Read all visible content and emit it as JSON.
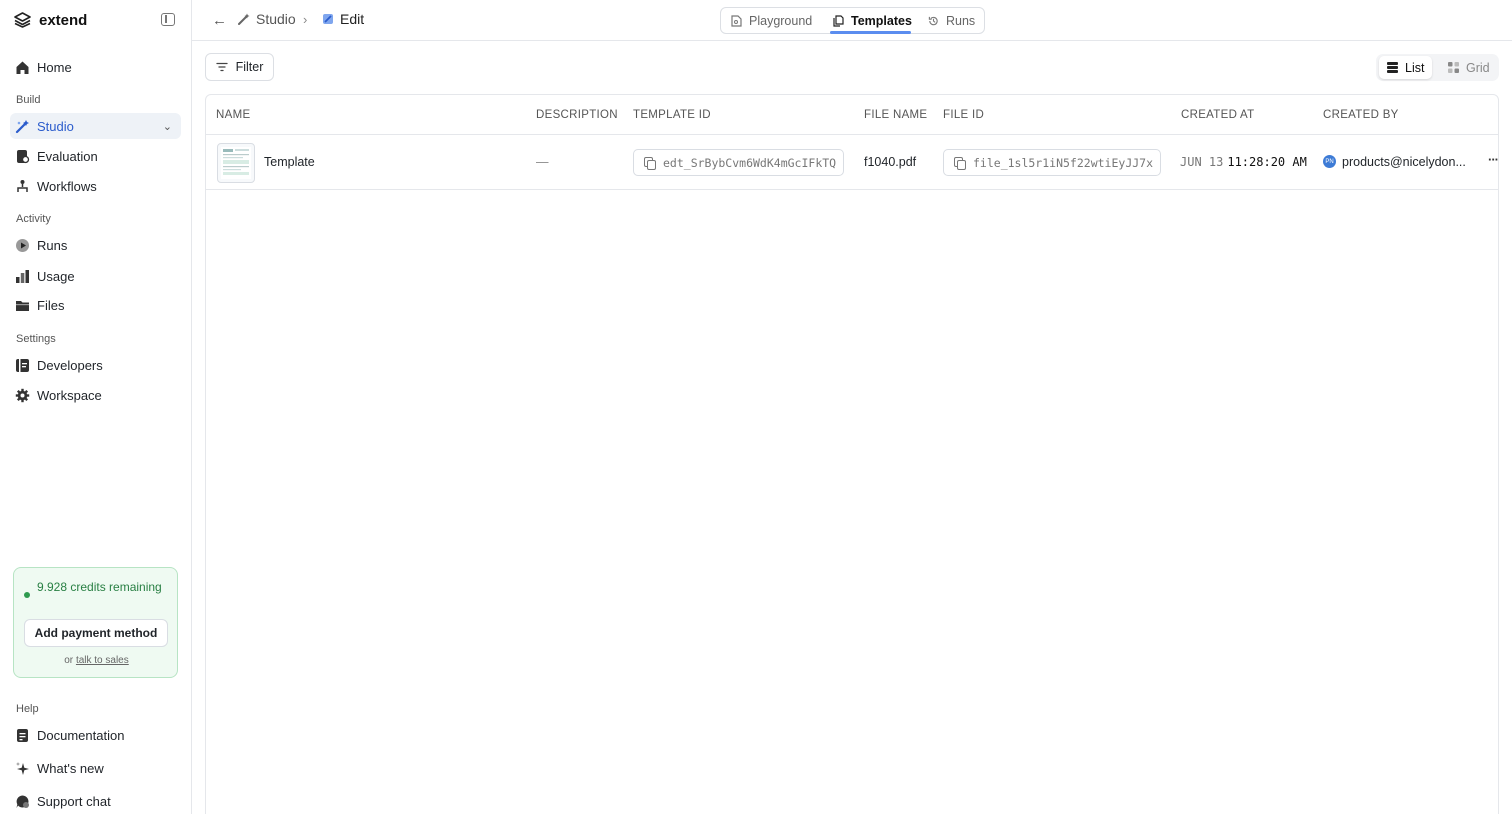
{
  "sidebar": {
    "brand": "extend",
    "items": {
      "home": "Home",
      "studio": "Studio",
      "evaluation": "Evaluation",
      "workflows": "Workflows",
      "runs": "Runs",
      "usage": "Usage",
      "files": "Files",
      "developers": "Developers",
      "workspace": "Workspace",
      "documentation": "Documentation",
      "whats_new": "What's new",
      "support_chat": "Support chat"
    },
    "sections": {
      "build": "Build",
      "activity": "Activity",
      "settings": "Settings",
      "help": "Help"
    },
    "credits": {
      "text": "9.928 credits remaining",
      "button": "Add payment method",
      "prefix": "or",
      "link": "talk to sales"
    }
  },
  "header": {
    "breadcrumb": [
      "Studio",
      "Edit"
    ],
    "tabs": [
      "Playground",
      "Templates",
      "Runs"
    ],
    "active_tab": "Templates"
  },
  "toolbar": {
    "filter": "Filter",
    "view_list": "List",
    "view_grid": "Grid"
  },
  "table": {
    "columns": [
      "NAME",
      "DESCRIPTION",
      "TEMPLATE ID",
      "FILE NAME",
      "FILE ID",
      "CREATED AT",
      "CREATED BY"
    ],
    "rows": [
      {
        "name": "Template",
        "description": "—",
        "template_id": "edt_SrBybCvm6WdK4mGcIFkTQ",
        "file_name": "f1040.pdf",
        "file_id": "file_1sl5r1iN5f22wtiEyJJ7x",
        "created_date": "JUN 13",
        "created_time": "11:28:20 AM",
        "avatar_initials": "PN",
        "created_by": "products@nicelydon..."
      }
    ]
  },
  "colors": {
    "accent": "#2b5ccc",
    "tab_underline": "#5b8def",
    "credits_green": "#287f43"
  }
}
